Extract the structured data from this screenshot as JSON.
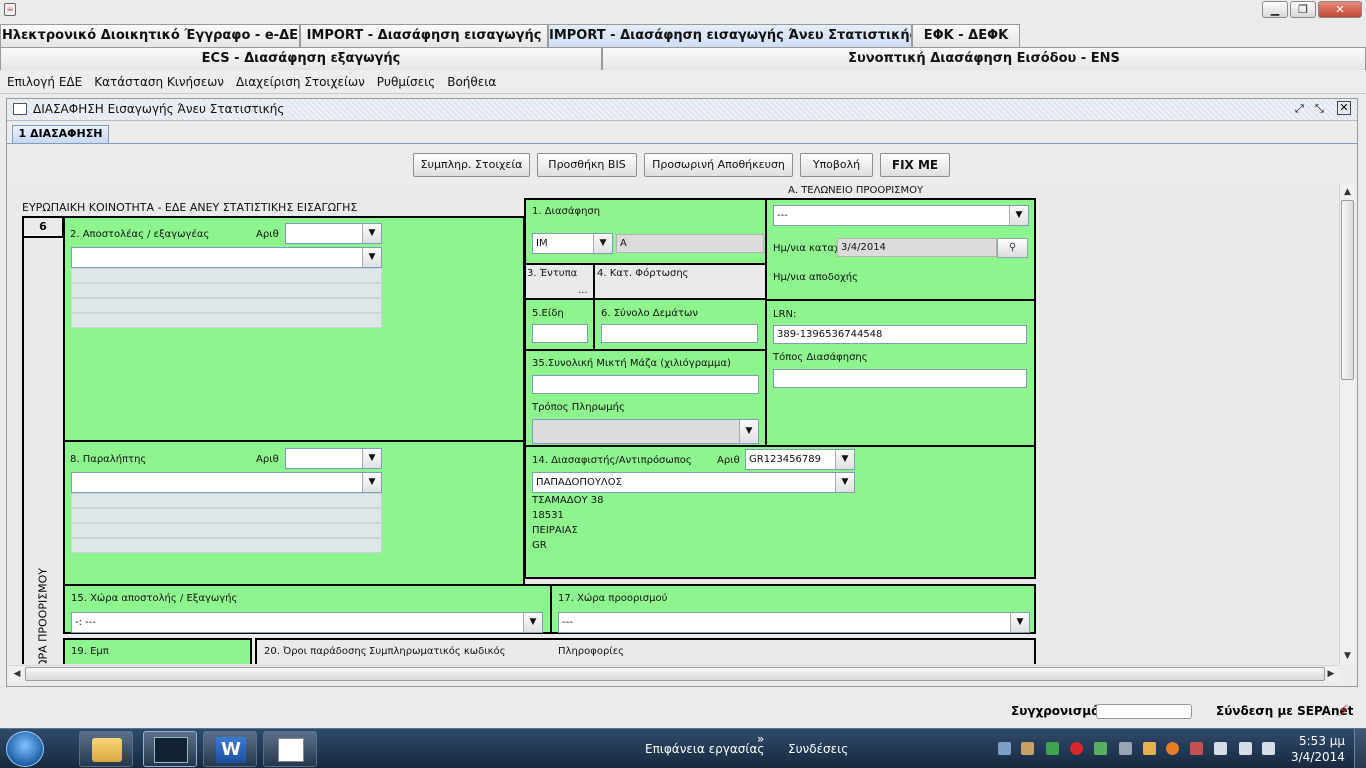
{
  "window_controls": {
    "minimize": "▁",
    "restore": "❐",
    "close": "✕"
  },
  "top_tabs_row1": [
    {
      "label": "Ηλεκτρονικό Διοικητικό Έγγραφο - e-ΔΕ",
      "active": false
    },
    {
      "label": "IMPORT - Διασάφηση εισαγωγής",
      "active": false
    },
    {
      "label": "IMPORT - Διασάφηση εισαγωγής Άνευ Στατιστικής",
      "active": true
    },
    {
      "label": "ΕΦΚ - ΔΕΦΚ",
      "active": false
    }
  ],
  "top_tabs_row2": [
    {
      "label": "ECS - Διασάφηση εξαγωγής"
    },
    {
      "label": "Συνοπτική Διασάφηση Εισόδου - ENS"
    }
  ],
  "menu": [
    "Επιλογή ΕΔΕ",
    "Κατάσταση Κινήσεων",
    "Διαχείριση Στοιχείων",
    "Ρυθμίσεις",
    "Βοήθεια"
  ],
  "frame": {
    "title": "ΔΙΑΣΑΦΗΣΗ Εισαγωγής Άνευ Στατιστικής",
    "inner_tab": "1 ΔΙΑΣΑΦΗΣΗ"
  },
  "toolbar": {
    "fill": "Συμπληρ. Στοιχεία",
    "add_bis": "Προσθήκη BIS",
    "save_temp": "Προσωρινή Αποθήκευση",
    "submit": "Υποβολή",
    "fixme": "FIX ME"
  },
  "form": {
    "header": "ΕΥΡΩΠΑΙΚΗ ΚΟΙΝΟΤΗΤΑ - ΕΔΕ ΑΝΕΥ ΣΤΑΤΙΣΤΙΚΗΣ ΕΙΣΑΓΩΓΗΣ",
    "side_num": "6",
    "side_vertical": "ΗΝ ΧΩΡΑ ΠΡΟΟΡΙΣΜΟΥ",
    "sender_label": "2. Αποστολέας / εξαγωγέας",
    "arith": "Αριθ",
    "receiver_label": "8. Παραλήπτης",
    "decl_label": "1. Διασάφηση",
    "decl_type": "IM",
    "decl_sub": "A",
    "forms_label": "3. Έντυπα",
    "forms_dots": "...",
    "loading_label": "4. Κατ. Φόρτωσης",
    "items_label": "5.Είδη",
    "packages_label": "6. Σύνολο Δεμάτων",
    "mass_label": "35.Συνολική Μικτή Μάζα (χιλιόγραμμα)",
    "payment_label": "Τρόπος Πληρωμής",
    "office_header": "Α. ΤΕΛΩΝΕΙΟ ΠΡΟΟΡΙΣΜΟΥ",
    "office_value": "---",
    "date_submit_label": "Ημ/νια καταχ.",
    "date_submit": "3/4/2014",
    "date_accept_label": "Ημ/νια αποδοχής",
    "lrn_label": "LRN:",
    "lrn": "389-1396536744548",
    "place_label": "Τόπος Διασάφησης",
    "rep_label": "14. Διασαφιστής/Αντιπρόσωπος",
    "rep_arith": "Αριθ",
    "rep_id": "GR123456789",
    "rep_name": "ΠΑΠΑΔΟΠΟΥΛΟΣ",
    "rep_address": [
      "ΤΣΑΜΑΔΟΥ 38",
      "18531",
      "ΠΕΙΡΑΙΑΣ",
      "GR"
    ],
    "country_dispatch_label": "15. Χώρα αποστολής / Εξαγωγής",
    "country_dispatch": "-: ---",
    "country_dest_label": "17. Χώρα προορισμού",
    "country_dest": "---",
    "trade_label": "19. Εμπ",
    "delivery_label": "20. Όροι παράδοσης",
    "supp_code_label": "Συμπληρωματικός κωδικός",
    "info_label": "Πληροφορίες"
  },
  "statusbar": {
    "sync": "Συγχρονισμός",
    "connection": "Σύνδεση με SEPAnet"
  },
  "taskbar": {
    "desktop": "Επιφάνεια εργασίας",
    "connections": "Συνδέσεις",
    "time": "5:53 μμ",
    "date": "3/4/2014",
    "chevron": "»"
  }
}
